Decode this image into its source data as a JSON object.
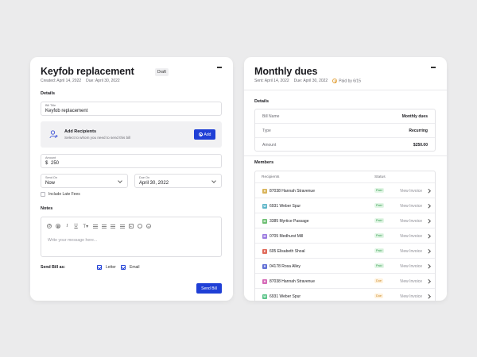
{
  "left": {
    "title": "Keyfob replacement",
    "badge": "Draft",
    "created": "Created: April 14, 2022",
    "due": "Due: April 30, 2022",
    "details_label": "Details",
    "bill_title": {
      "label": "Bill Title",
      "value": "Keyfob replacement"
    },
    "recipients": {
      "title": "Add Recipients",
      "subtitle": "Select to whom you need to send this bill",
      "add_label": "Add"
    },
    "amount": {
      "label": "Amount",
      "currency": "$",
      "value": "250"
    },
    "send_on": {
      "label": "Send On",
      "value": "Now"
    },
    "due_on": {
      "label": "Due On",
      "value": "April 30, 2022"
    },
    "late_fees": {
      "label": "Include Late Fees",
      "checked": false
    },
    "notes_label": "Notes",
    "notes_toolbar": [
      "undo-icon",
      "bold-icon",
      "italic-icon",
      "underline-icon",
      "text-size-icon",
      "align-left-icon",
      "align-center-icon",
      "align-right-icon",
      "list-icon",
      "image-icon",
      "emoji-icon",
      "link-icon"
    ],
    "notes_placeholder": "Write your message here...",
    "send_as_label": "Send Bill as:",
    "letter_label": "Letter",
    "email_label": "Email",
    "send_button": "Send Bill"
  },
  "right": {
    "title": "Monthly dues",
    "sent": "Sent: April 14, 2022",
    "due": "Due: April 30, 2022",
    "paid_by": "Paid by 6/15",
    "details_label": "Details",
    "details": [
      {
        "key": "Bill Name",
        "value": "Monthly dues"
      },
      {
        "key": "Type",
        "value": "Recurring"
      },
      {
        "key": "Amount",
        "value": "$250.00"
      }
    ],
    "members_label": "Members",
    "members_headers": {
      "recipients": "Recipients",
      "status": "Status"
    },
    "members": [
      {
        "initial": "H",
        "name": "87038 Hannah Stravenue",
        "status": "Paid",
        "color": "#d9b45a",
        "action": "View Invoice"
      },
      {
        "initial": "W",
        "name": "6931 Weber Spur",
        "status": "Paid",
        "color": "#5fb6c9",
        "action": "View Invoice"
      },
      {
        "initial": "M",
        "name": "3385 Myrtice Passage",
        "status": "Paid",
        "color": "#6ebf73",
        "action": "View Invoice"
      },
      {
        "initial": "M",
        "name": "0705 Medhurst Mill",
        "status": "Paid",
        "color": "#9b7be0",
        "action": "View Invoice"
      },
      {
        "initial": "E",
        "name": "605 Elisabeth Shoal",
        "status": "Paid",
        "color": "#e06a5a",
        "action": "View Invoice"
      },
      {
        "initial": "R",
        "name": "04178 Rosa Alley",
        "status": "Paid",
        "color": "#6271d6",
        "action": "View Invoice"
      },
      {
        "initial": "H",
        "name": "87038 Hannah Stravenue",
        "status": "Due",
        "color": "#d66bb8",
        "action": "View Invoice"
      },
      {
        "initial": "W",
        "name": "6931 Weber Spur",
        "status": "Due",
        "color": "#5cc48a",
        "action": "View Invoice"
      }
    ]
  }
}
